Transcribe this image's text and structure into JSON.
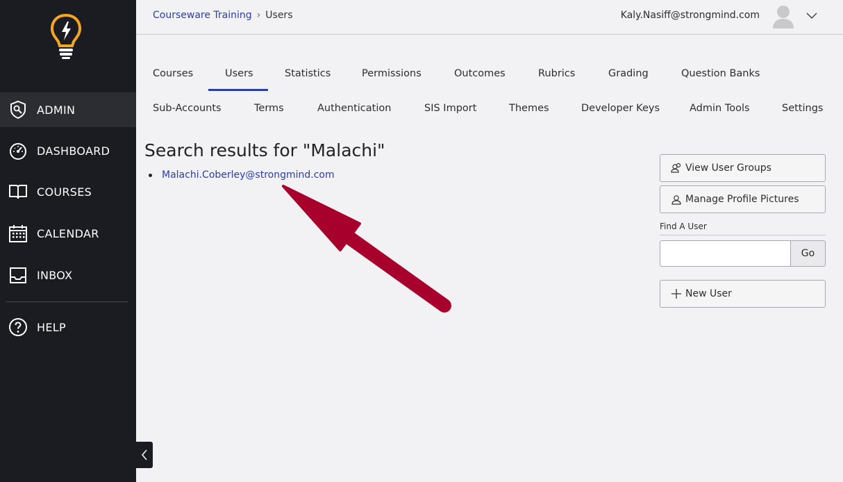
{
  "sidebar": {
    "items": [
      {
        "label": "ADMIN",
        "icon": "admin-shield-icon"
      },
      {
        "label": "DASHBOARD",
        "icon": "dashboard-gauge-icon"
      },
      {
        "label": "COURSES",
        "icon": "book-icon"
      },
      {
        "label": "CALENDAR",
        "icon": "calendar-icon"
      },
      {
        "label": "INBOX",
        "icon": "inbox-icon"
      },
      {
        "label": "HELP",
        "icon": "help-icon"
      }
    ],
    "logo": "lightbulb-logo-icon",
    "accent_color": "#f5a623"
  },
  "header": {
    "breadcrumb": {
      "parent": "Courseware Training",
      "current": "Users"
    },
    "user_email": "Kaly.Nasiff@strongmind.com"
  },
  "tabs": {
    "row1": [
      "Courses",
      "Users",
      "Statistics",
      "Permissions",
      "Outcomes",
      "Rubrics",
      "Grading",
      "Question Banks"
    ],
    "row2": [
      "Sub-Accounts",
      "Terms",
      "Authentication",
      "SIS Import",
      "Themes",
      "Developer Keys",
      "Admin Tools",
      "Settings"
    ],
    "active": "Users"
  },
  "main": {
    "title": "Search results for \"Malachi\"",
    "results": [
      "Malachi.Coberley@strongmind.com"
    ]
  },
  "panel": {
    "view_groups": "View User Groups",
    "manage_pictures": "Manage Profile Pictures",
    "find_label": "Find A User",
    "find_value": "",
    "go": "Go",
    "new_user": "New User"
  },
  "colors": {
    "link": "#2b3ea6",
    "sidebar_bg": "#1b1c22",
    "arrow": "#a8002c"
  }
}
